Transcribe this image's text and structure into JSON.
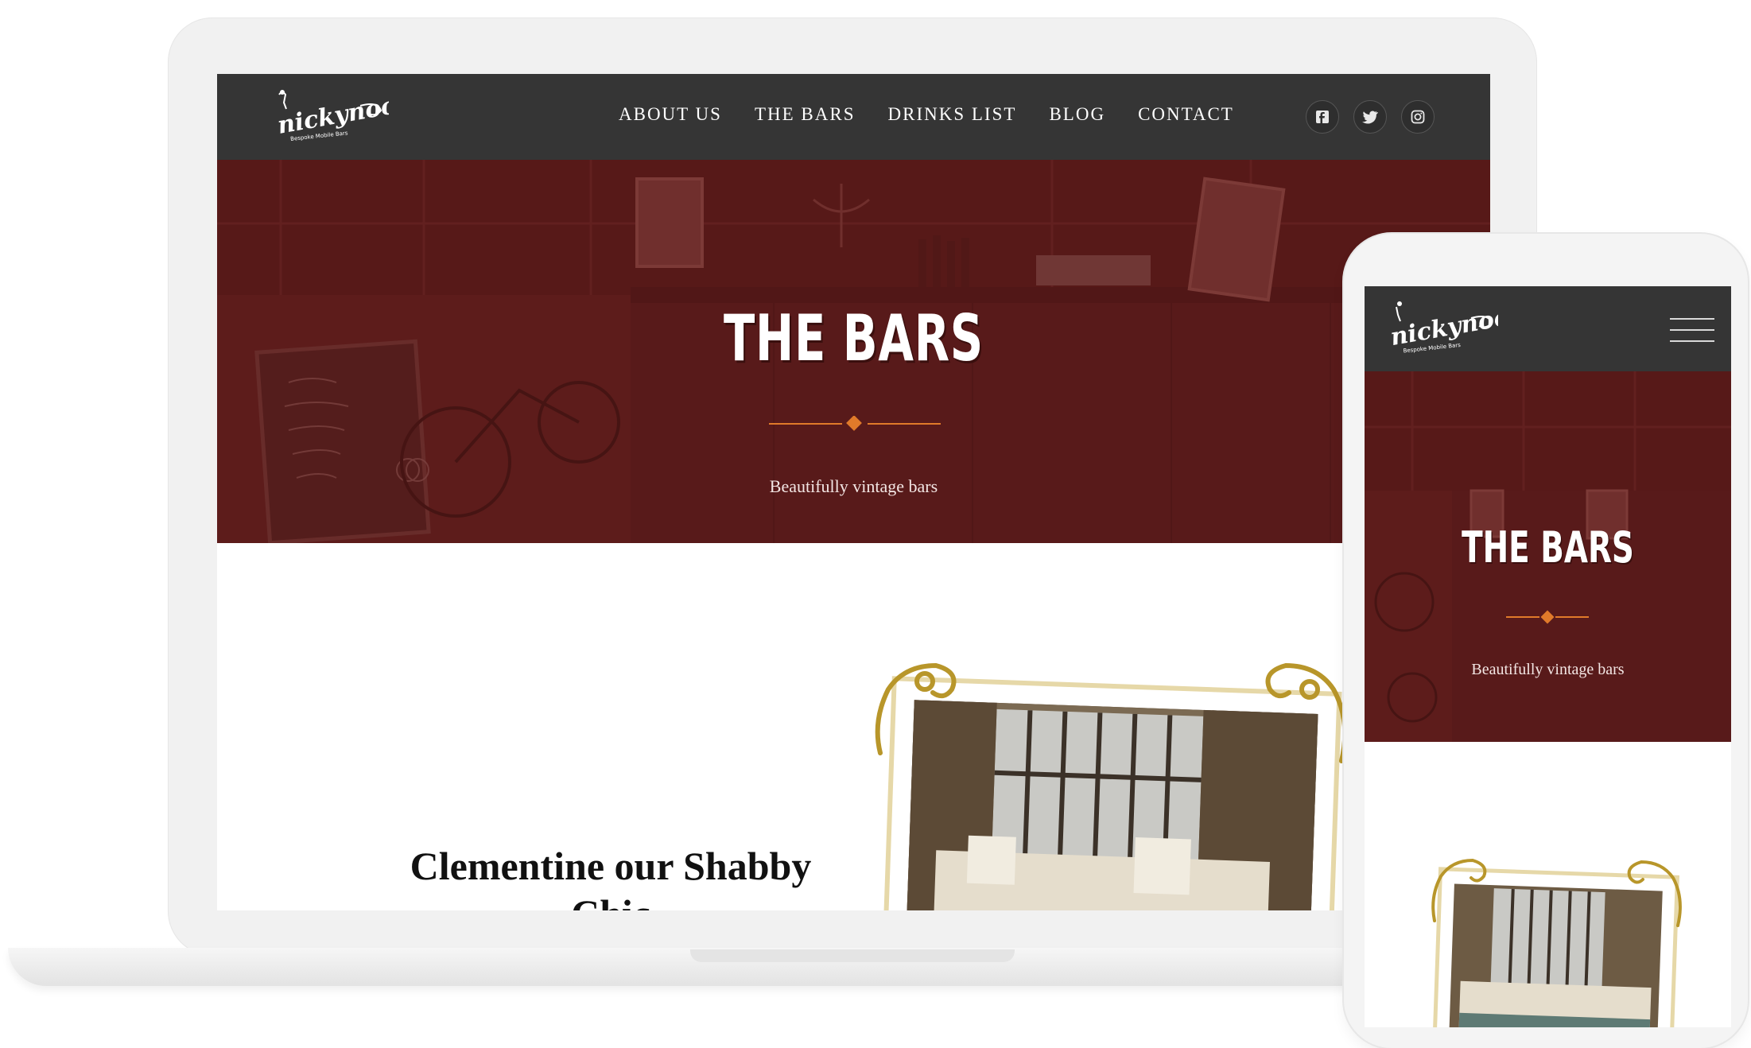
{
  "brand": {
    "logo_text": "nickynoo",
    "logo_tagline": "Bespoke Mobile Bars"
  },
  "desktop": {
    "nav": {
      "items": [
        {
          "label": "ABOUT US"
        },
        {
          "label": "THE BARS"
        },
        {
          "label": "DRINKS LIST"
        },
        {
          "label": "BLOG"
        },
        {
          "label": "CONTACT"
        }
      ],
      "social_icons": [
        "facebook-icon",
        "twitter-icon",
        "instagram-icon"
      ]
    },
    "hero": {
      "title": "THE BARS",
      "subtitle": "Beautifully vintage bars"
    },
    "content": {
      "heading": "Clementine our Shabby Chic"
    }
  },
  "mobile": {
    "hero": {
      "title": "THE BARS",
      "subtitle": "Beautifully vintage bars"
    }
  },
  "colors": {
    "nav_bg": "#353535",
    "hero_bg": "#5f1e1c",
    "accent": "#e07a2a",
    "frame_gold": "#b8962a"
  }
}
